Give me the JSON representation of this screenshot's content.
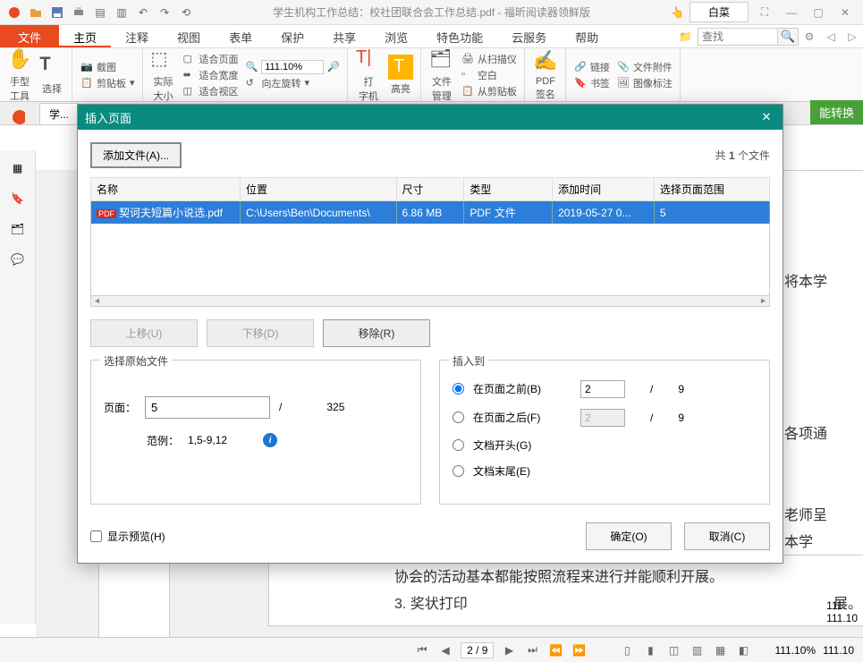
{
  "app": {
    "title": "学生机构工作总结：校社团联合会工作总结.pdf - 福昕阅读器领鲜版",
    "user": "白菜",
    "search_placeholder": "查找"
  },
  "tabs": {
    "file": "文件",
    "items": [
      "主页",
      "注释",
      "视图",
      "表单",
      "保护",
      "共享",
      "浏览",
      "特色功能",
      "云服务",
      "帮助"
    ]
  },
  "toolbar": {
    "hand": "手型\n工具",
    "select": "选择",
    "screenshot": "截图",
    "clipboard": "剪贴板",
    "actual": "实际\n大小",
    "fit_page": "适合页面",
    "fit_width": "适合宽度",
    "fit_visible": "适合视区",
    "zoom": "111.10%",
    "rotate_l": "向左旋转",
    "typewriter": "打\n字机",
    "highlight": "高亮",
    "file_mgmt": "文件\n管理",
    "scan": "从扫描仪",
    "blank": "空白",
    "clip": "从剪贴板",
    "pdf": "PDF\n签名",
    "link": "链接",
    "bookmark": "书签",
    "attach": "文件附件",
    "img_note": "图像标注"
  },
  "doc_tab": "学...",
  "convert": "能转换",
  "side": {
    "page_label": "页面"
  },
  "background_text": {
    "ln1": "见将本学",
    "ln2": "的各项通",
    "ln3": "口老师呈",
    "ln4": "在本学",
    "ln5": "协会的活动基本都能按照流程来进行并能顺利开展。",
    "ln6": "3. 奖状打印",
    "ln7": "展。",
    "z1": "111.",
    "z2": "111.10"
  },
  "statusbar": {
    "page": "2 / 9",
    "zoom1": "111.10%",
    "zoom2": "111.10"
  },
  "dialog": {
    "title": "插入页面",
    "add_file": "添加文件(A)...",
    "file_count_prefix": "共 ",
    "file_count_n": "1",
    "file_count_suffix": " 个文件",
    "cols": {
      "name": "名称",
      "loc": "位置",
      "size": "尺寸",
      "type": "类型",
      "added": "添加时间",
      "range": "选择页面范围"
    },
    "rows": [
      {
        "name": "契诃夫短篇小说选.pdf",
        "loc": "C:\\Users\\Ben\\Documents\\",
        "size": "6.86 MB",
        "type": "PDF 文件",
        "added": "2019-05-27 0...",
        "range": "5"
      }
    ],
    "move_up": "上移(U)",
    "move_down": "下移(D)",
    "remove": "移除(R)",
    "src_legend": "选择原始文件",
    "page_label": "页面：",
    "page_value": "5",
    "total_sep": "/",
    "total_pages": "325",
    "range_label": "范例：",
    "range_sample": "1,5-9,12",
    "dst_legend": "插入到",
    "before": "在页面之前(B)",
    "after": "在页面之后(F)",
    "doc_start": "文档开头(G)",
    "doc_end": "文档末尾(E)",
    "before_val": "2",
    "after_val": "2",
    "dst_total": "9",
    "preview_chk": "显示预览(H)",
    "ok": "确定(O)",
    "cancel": "取消(C)"
  }
}
